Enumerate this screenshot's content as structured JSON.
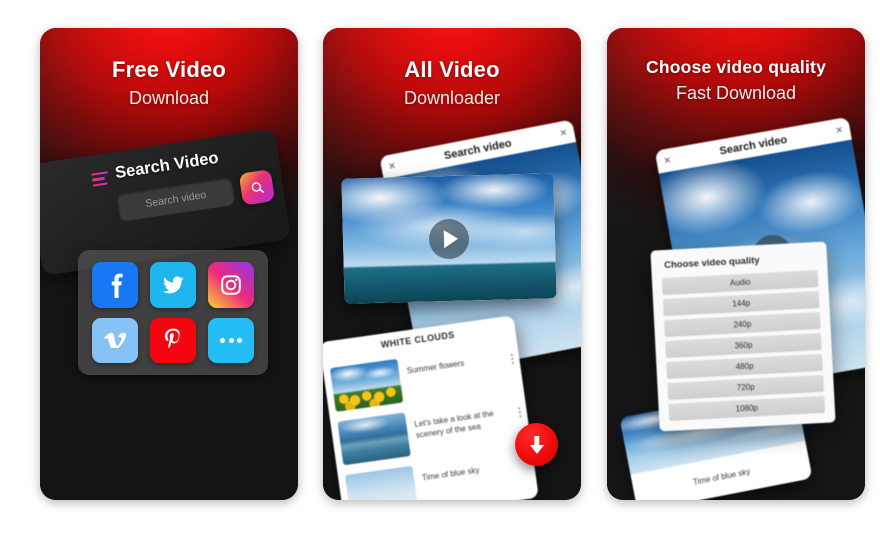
{
  "page": {
    "background_color": "#ffffff",
    "card_accent": "#e60606",
    "card_dark": "#151515"
  },
  "cards": [
    {
      "id": "card-1",
      "heading_line1": "Free Video",
      "heading_line2": "Download",
      "phone": {
        "menu_icon": "hamburger-icon",
        "title": "Search Video",
        "search_placeholder": "Search video",
        "search_button_icon": "search-icon"
      },
      "social": {
        "items": [
          {
            "name": "facebook",
            "glyph": "f",
            "color": "#1877f2"
          },
          {
            "name": "twitter",
            "glyph": "ᵗ",
            "color": "#1fb6f0"
          },
          {
            "name": "instagram",
            "glyph": "▢",
            "color": "#ee2a7b"
          },
          {
            "name": "vimeo",
            "glyph": "v",
            "color": "#86c2f5"
          },
          {
            "name": "pinterest",
            "glyph": "P",
            "color": "#f5050f"
          },
          {
            "name": "more",
            "glyph": "⋯",
            "color": "#24bdf5"
          }
        ]
      }
    },
    {
      "id": "card-2",
      "heading_line1": "All Video",
      "heading_line2": "Downloader",
      "browser": {
        "title": "Search video",
        "close_icon": "close-icon"
      },
      "video_player": {
        "play_icon": "play-icon",
        "thumbnail": "ocean-sky"
      },
      "results_header": "WHITE CLOUDS",
      "results": [
        {
          "title": "Summer flowers",
          "thumbnail": "sunflower-field",
          "menu_icon": "kebab-menu-icon"
        },
        {
          "title": "Let's take a look at the scenery of the sea",
          "thumbnail": "sea-mountains",
          "menu_icon": "kebab-menu-icon"
        },
        {
          "title": "Time of blue sky",
          "thumbnail": "blue-sky",
          "menu_icon": "kebab-menu-icon"
        }
      ],
      "download_fab": {
        "icon": "download-arrow-icon",
        "color": "#ef0d0d"
      }
    },
    {
      "id": "card-3",
      "heading_line1": "Choose video quality",
      "heading_line2": "Fast Download",
      "browser": {
        "title": "Search video",
        "close_icon": "close-icon"
      },
      "video_player": {
        "play_icon": "play-icon",
        "thumbnail": "blue-sky-clouds"
      },
      "quality_dialog": {
        "title": "Choose video quality",
        "options": [
          "Audio",
          "144p",
          "240p",
          "360p",
          "480p",
          "720p",
          "1080p"
        ]
      },
      "bottom_result": "Time of blue sky"
    }
  ]
}
